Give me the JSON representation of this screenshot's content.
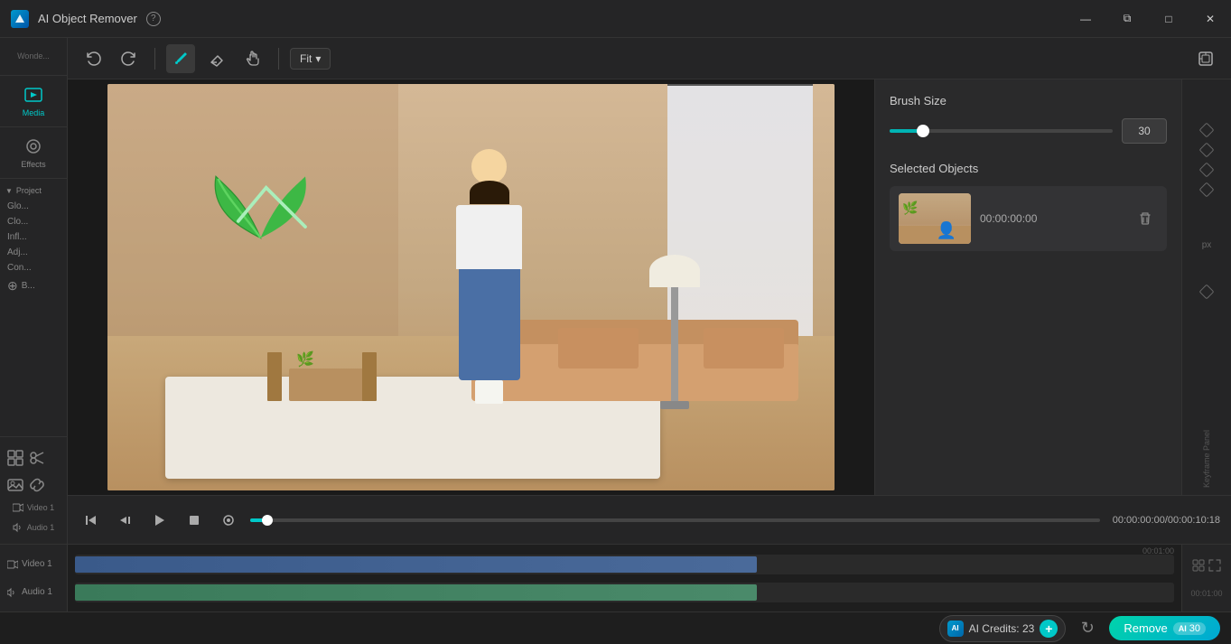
{
  "app": {
    "title": "AI Object Remover",
    "help_tooltip": "Help"
  },
  "window_controls": {
    "minimize": "—",
    "maximize": "□",
    "restore": "⧉",
    "close": "✕"
  },
  "toolbar": {
    "undo_label": "Undo",
    "redo_label": "Redo",
    "brush_label": "Brush",
    "eraser_label": "Eraser",
    "hand_label": "Hand",
    "fit_label": "Fit",
    "export_label": "Export"
  },
  "brush_size": {
    "label": "Brush Size",
    "value": "30",
    "slider_pct": 15
  },
  "selected_objects": {
    "label": "Selected Objects",
    "items": [
      {
        "id": "obj-1",
        "timecode": "00:00:00:00",
        "thumbnail_alt": "Video clip with plant overlay"
      }
    ]
  },
  "playback": {
    "time_current": "00:00:00:00",
    "time_total": "00:00:10:18",
    "time_display": "00:00:00:00/00:00:10:18"
  },
  "bottom_bar": {
    "credits_label": "AI Credits: 23",
    "remove_label": "Remove",
    "ai_credits_count": "30"
  },
  "timeline": {
    "video_label": "Video 1",
    "audio_label": "Audio 1",
    "time_marker": "00:01:00"
  },
  "left_nav": {
    "media_label": "Media",
    "effects_label": "Effects"
  },
  "project_panel": {
    "project_label": "Project",
    "sections": [
      "Glo...",
      "Clo...",
      "Infl...",
      "Adj...",
      "Con..."
    ]
  },
  "icons": {
    "undo": "↩",
    "redo": "↪",
    "brush": "✏",
    "eraser": "⌫",
    "hand": "✋",
    "chevron_down": "▾",
    "export": "⊡",
    "delete": "🗑",
    "skip_back": "⏮",
    "frame_back": "◁|",
    "play": "▶",
    "stop": "■",
    "dot": "●",
    "add": "+",
    "refresh": "↻",
    "diamond": "◇",
    "grid": "⊞",
    "scissors": "✂",
    "image_plus": "🖼",
    "music": "♪",
    "layers": "⊕"
  }
}
